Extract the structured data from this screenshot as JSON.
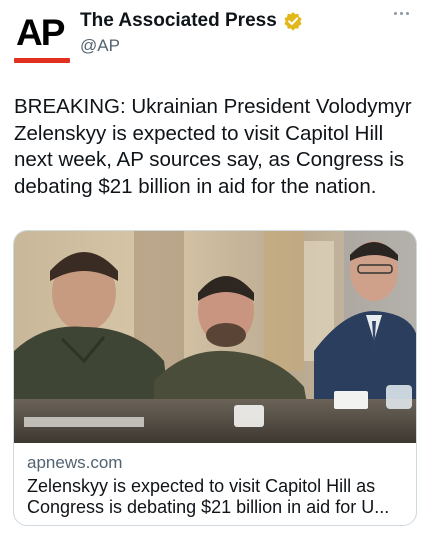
{
  "account": {
    "display_name": "The Associated Press",
    "handle": "@AP",
    "avatar_text": "AP",
    "verified_badge": "gold-verified-badge",
    "brand_color": "#e0301e"
  },
  "tweet": {
    "text": "BREAKING: Ukrainian President Volodymyr Zelenskyy is expected to visit Capitol Hill next week, AP sources say, as Congress is debating $21 billion in aid for the nation."
  },
  "link_card": {
    "domain": "apnews.com",
    "title": "Zelenskyy is expected to visit Capitol Hill as Congress is debating $21 billion in aid for U..."
  },
  "icons": {
    "more": "more-options-icon",
    "verified": "verified-badge-icon"
  }
}
